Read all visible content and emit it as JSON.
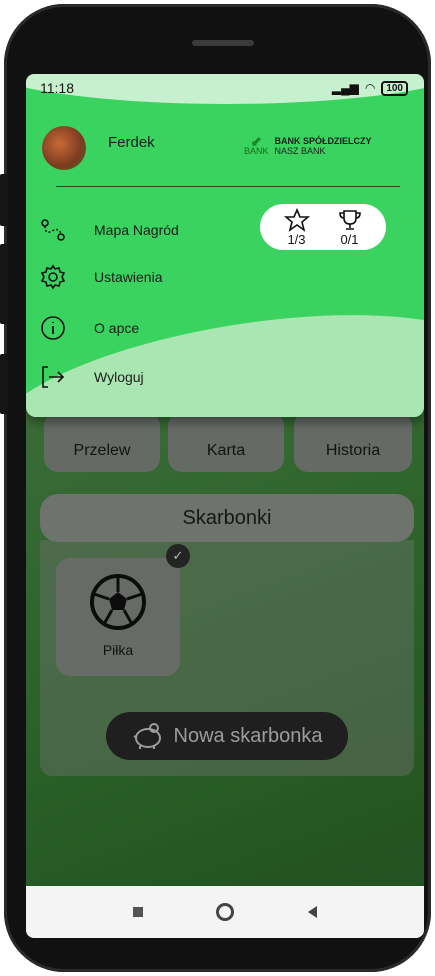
{
  "status_bar": {
    "time": "11:18",
    "battery": "100"
  },
  "drawer": {
    "username": "Ferdek",
    "bank": {
      "logo_text": "BANK",
      "name": "BANK SPÓŁDZIELCZY",
      "subtitle": "NASZ BANK"
    },
    "achievements": [
      {
        "icon": "star-icon",
        "value": "1/3"
      },
      {
        "icon": "trophy-icon",
        "value": "0/1"
      }
    ],
    "menu": [
      {
        "label": "Mapa Nagród",
        "icon": "route-icon"
      },
      {
        "label": "Ustawienia",
        "icon": "gear-icon"
      },
      {
        "label": "O apce",
        "icon": "info-icon"
      },
      {
        "label": "Wyloguj",
        "icon": "logout-icon"
      }
    ]
  },
  "actions": {
    "przelew": "Przelew",
    "karta": "Karta",
    "historia": "Historia"
  },
  "skarbonki": {
    "title": "Skarbonki",
    "items": [
      {
        "label": "Piłka",
        "icon": "soccer-ball-icon"
      }
    ],
    "new_button": "Nowa skarbonka"
  },
  "colors": {
    "drawer_green": "#3bd35f",
    "background_green": "#3f8a3b"
  }
}
